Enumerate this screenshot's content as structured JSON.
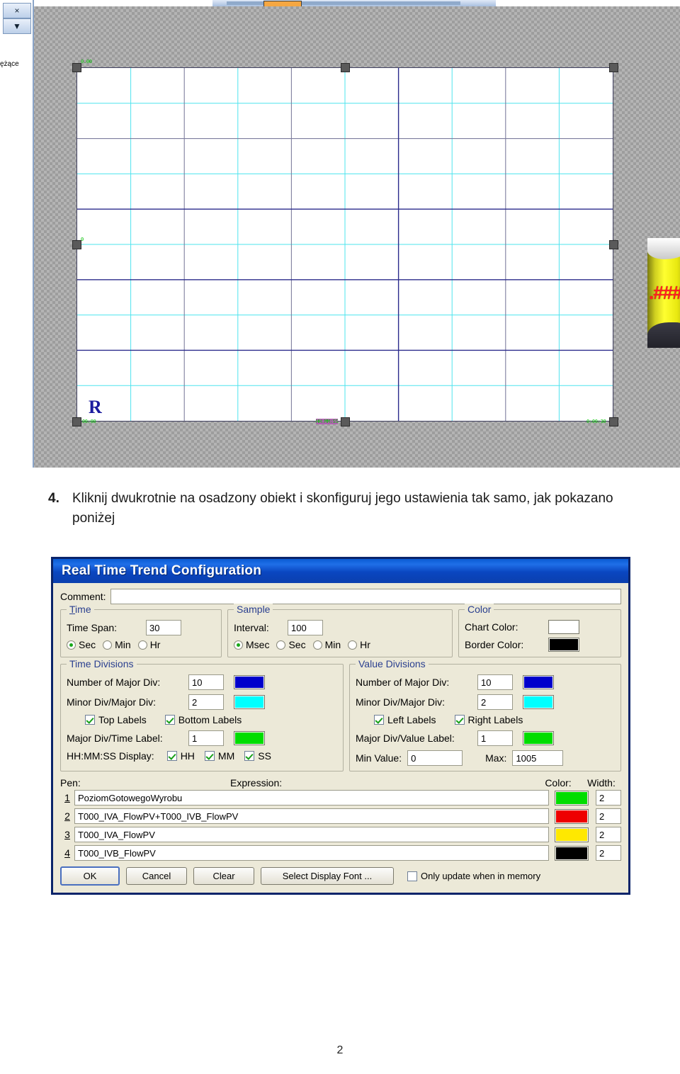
{
  "screenshot": {
    "left_panel": {
      "close_label": "×",
      "dropdown_label": "▼",
      "partial_text": "ężące"
    },
    "trend_object": {
      "corner_letter": "R",
      "top_left_label": "0.00",
      "left_mid_label": "0",
      "bottom_left_label": "0:00:00",
      "bottom_center_label": "HH:MM:SS",
      "bottom_right_label": "0:00:30",
      "chart_color": "#FFFFFF",
      "border_color": "#000000",
      "major_div_color": "#0000AA",
      "minor_div_color": "#00FFFF"
    },
    "tank": {
      "value_text": ".###"
    }
  },
  "instruction": {
    "number": "4.",
    "text": "Kliknij dwukrotnie na osadzony obiekt i skonfiguruj jego ustawienia tak samo, jak pokazano poniżej"
  },
  "dialog": {
    "title": "Real Time Trend Configuration",
    "comment": {
      "label": "Comment:",
      "value": "",
      "placeholder": ""
    },
    "time": {
      "group_title": "Time",
      "span_label": "Time Span:",
      "span_value": "30",
      "units": [
        {
          "label": "Sec",
          "selected": true
        },
        {
          "label": "Min",
          "selected": false
        },
        {
          "label": "Hr",
          "selected": false
        }
      ]
    },
    "sample": {
      "group_title": "Sample",
      "interval_label": "Interval:",
      "interval_value": "100",
      "units": [
        {
          "label": "Msec",
          "selected": true
        },
        {
          "label": "Sec",
          "selected": false
        },
        {
          "label": "Min",
          "selected": false
        },
        {
          "label": "Hr",
          "selected": false
        }
      ]
    },
    "color": {
      "group_title": "Color",
      "chart_label": "Chart Color:",
      "chart_value": "#FFFFFF",
      "border_label": "Border Color:",
      "border_value": "#000000"
    },
    "time_divisions": {
      "group_title": "Time Divisions",
      "major_label": "Number of Major Div:",
      "major_value": "10",
      "major_color": "#0000CC",
      "minor_label": "Minor Div/Major Div:",
      "minor_value": "2",
      "minor_color": "#00FFFF",
      "top_labels": {
        "label": "Top Labels",
        "checked": true
      },
      "bottom_labels": {
        "label": "Bottom Labels",
        "checked": true
      },
      "label_div_label": "Major Div/Time Label:",
      "label_div_value": "1",
      "label_div_color": "#00DD00",
      "display_label": "HH:MM:SS Display:",
      "display_parts": [
        {
          "label": "HH",
          "checked": true
        },
        {
          "label": "MM",
          "checked": true
        },
        {
          "label": "SS",
          "checked": true
        }
      ]
    },
    "value_divisions": {
      "group_title": "Value Divisions",
      "major_label": "Number of Major Div:",
      "major_value": "10",
      "major_color": "#0000CC",
      "minor_label": "Minor Div/Major Div:",
      "minor_value": "2",
      "minor_color": "#00FFFF",
      "left_labels": {
        "label": "Left Labels",
        "checked": true
      },
      "right_labels": {
        "label": "Right Labels",
        "checked": true
      },
      "label_div_label": "Major Div/Value Label:",
      "label_div_value": "1",
      "label_div_color": "#00DD00",
      "min_label": "Min Value:",
      "min_value": "0",
      "max_label": "Max:",
      "max_value": "1005"
    },
    "pens": {
      "pen_header": "Pen:",
      "expression_header": "Expression:",
      "color_header": "Color:",
      "width_header": "Width:",
      "rows": [
        {
          "no": "1",
          "expression": "PoziomGotowegoWyrobu",
          "color": "#00DD00",
          "width": "2"
        },
        {
          "no": "2",
          "expression": "T000_IVA_FlowPV+T000_IVB_FlowPV",
          "color": "#EE0000",
          "width": "2"
        },
        {
          "no": "3",
          "expression": "T000_IVA_FlowPV",
          "color": "#FFE800",
          "width": "2"
        },
        {
          "no": "4",
          "expression": "T000_IVB_FlowPV",
          "color": "#000000",
          "width": "2"
        }
      ]
    },
    "buttons": {
      "ok": "OK",
      "cancel": "Cancel",
      "clear": "Clear",
      "font": "Select Display Font ...",
      "only_update": {
        "label": "Only update when in memory",
        "checked": false
      }
    }
  },
  "footer": {
    "page": "2"
  }
}
